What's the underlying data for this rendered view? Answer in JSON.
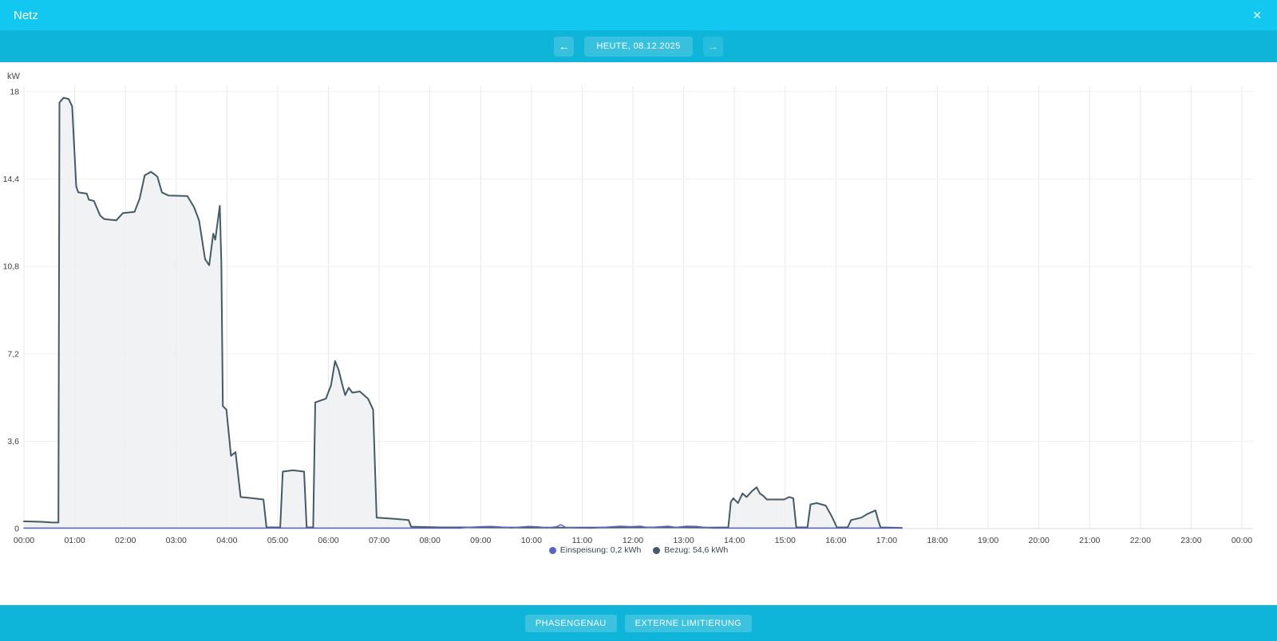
{
  "header": {
    "title": "Netz",
    "close_icon": "✕"
  },
  "nav": {
    "prev_icon": "←",
    "next_icon": "→",
    "date_label": "HEUTE, 08.12.2025"
  },
  "colors": {
    "header_bar": "#12c8f1",
    "toolbar_bar": "#0fb5d8",
    "footer_bar": "#0fb5d8",
    "grid_vertical": "#e9e9e9",
    "grid_horizontal": "#f1f1f1",
    "axis_baseline": "#d8d8d8",
    "tick_text": "#3d3d3d"
  },
  "chart_data": {
    "type": "area",
    "title": "",
    "xlabel": "",
    "ylabel": "kW",
    "xlim": [
      0,
      24
    ],
    "ylim": [
      0,
      18
    ],
    "grid": true,
    "legend_position": "bottom",
    "x_tick_labels": [
      "00:00",
      "01:00",
      "02:00",
      "03:00",
      "04:00",
      "05:00",
      "06:00",
      "07:00",
      "08:00",
      "09:00",
      "10:00",
      "11:00",
      "12:00",
      "13:00",
      "14:00",
      "15:00",
      "16:00",
      "17:00",
      "18:00",
      "19:00",
      "20:00",
      "21:00",
      "22:00",
      "23:00",
      "00:00"
    ],
    "y_ticks": [
      {
        "value": 0,
        "label": "0"
      },
      {
        "value": 3.6,
        "label": "3,6"
      },
      {
        "value": 7.2,
        "label": "7,2"
      },
      {
        "value": 10.8,
        "label": "10,8"
      },
      {
        "value": 14.4,
        "label": "14,4"
      },
      {
        "value": 18,
        "label": "18"
      }
    ],
    "series": [
      {
        "name": "Einspeisung",
        "legend_label": "Einspeisung: 0,2 kWh",
        "total": "0,2 kWh",
        "color": "#5a64c8",
        "fill": "none",
        "points": [
          [
            0,
            0.02
          ],
          [
            8.6,
            0.02
          ],
          [
            8.8,
            0.06
          ],
          [
            9,
            0.08
          ],
          [
            9.2,
            0.09
          ],
          [
            9.45,
            0.06
          ],
          [
            9.6,
            0.03
          ],
          [
            9.75,
            0.06
          ],
          [
            9.95,
            0.09
          ],
          [
            10.15,
            0.07
          ],
          [
            10.3,
            0.03
          ],
          [
            10.5,
            0.08
          ],
          [
            10.58,
            0.16
          ],
          [
            10.68,
            0.05
          ],
          [
            10.9,
            0.03
          ],
          [
            11.2,
            0.02
          ],
          [
            11.55,
            0.07
          ],
          [
            11.75,
            0.1
          ],
          [
            11.95,
            0.08
          ],
          [
            12.15,
            0.1
          ],
          [
            12.3,
            0.04
          ],
          [
            12.55,
            0.08
          ],
          [
            12.7,
            0.1
          ],
          [
            12.85,
            0.05
          ],
          [
            13.05,
            0.1
          ],
          [
            13.25,
            0.09
          ],
          [
            13.45,
            0.04
          ],
          [
            13.6,
            0.02
          ],
          [
            17.3,
            0.02
          ]
        ]
      },
      {
        "name": "Bezug",
        "legend_label": "Bezug: 54,6 kWh",
        "total": "54,6 kWh",
        "color": "#455a64",
        "fill": "#eceff1",
        "points": [
          [
            0,
            0.3
          ],
          [
            0.35,
            0.28
          ],
          [
            0.55,
            0.25
          ],
          [
            0.68,
            0.25
          ],
          [
            0.7,
            17.55
          ],
          [
            0.78,
            17.75
          ],
          [
            0.88,
            17.7
          ],
          [
            0.95,
            17.4
          ],
          [
            1.03,
            14.1
          ],
          [
            1.07,
            13.85
          ],
          [
            1.24,
            13.8
          ],
          [
            1.28,
            13.55
          ],
          [
            1.38,
            13.5
          ],
          [
            1.5,
            12.9
          ],
          [
            1.58,
            12.75
          ],
          [
            1.82,
            12.7
          ],
          [
            1.95,
            13
          ],
          [
            2.18,
            13.05
          ],
          [
            2.28,
            13.6
          ],
          [
            2.38,
            14.55
          ],
          [
            2.5,
            14.7
          ],
          [
            2.57,
            14.6
          ],
          [
            2.63,
            14.5
          ],
          [
            2.72,
            13.85
          ],
          [
            2.85,
            13.72
          ],
          [
            3.22,
            13.7
          ],
          [
            3.35,
            13.25
          ],
          [
            3.45,
            12.7
          ],
          [
            3.57,
            11.1
          ],
          [
            3.65,
            10.85
          ],
          [
            3.73,
            12.15
          ],
          [
            3.77,
            11.9
          ],
          [
            3.86,
            13.3
          ],
          [
            3.89,
            11
          ],
          [
            3.92,
            5.05
          ],
          [
            3.99,
            4.9
          ],
          [
            4.08,
            3
          ],
          [
            4.17,
            3.15
          ],
          [
            4.27,
            1.3
          ],
          [
            4.5,
            1.25
          ],
          [
            4.72,
            1.2
          ],
          [
            4.78,
            0.05
          ],
          [
            5.05,
            0.05
          ],
          [
            5.1,
            2.35
          ],
          [
            5.3,
            2.4
          ],
          [
            5.52,
            2.35
          ],
          [
            5.57,
            0.05
          ],
          [
            5.7,
            0.05
          ],
          [
            5.74,
            5.2
          ],
          [
            5.95,
            5.35
          ],
          [
            6.05,
            5.9
          ],
          [
            6.13,
            6.9
          ],
          [
            6.2,
            6.55
          ],
          [
            6.27,
            5.95
          ],
          [
            6.33,
            5.5
          ],
          [
            6.4,
            5.8
          ],
          [
            6.47,
            5.6
          ],
          [
            6.62,
            5.65
          ],
          [
            6.78,
            5.35
          ],
          [
            6.88,
            4.9
          ],
          [
            6.95,
            0.45
          ],
          [
            7.3,
            0.4
          ],
          [
            7.58,
            0.35
          ],
          [
            7.63,
            0.08
          ],
          [
            8.2,
            0.05
          ],
          [
            9,
            0.05
          ],
          [
            10,
            0.04
          ],
          [
            11,
            0.04
          ],
          [
            12,
            0.05
          ],
          [
            13,
            0.05
          ],
          [
            13.55,
            0.04
          ],
          [
            13.88,
            0.05
          ],
          [
            13.93,
            1.1
          ],
          [
            13.98,
            1.25
          ],
          [
            14.07,
            1.05
          ],
          [
            14.16,
            1.45
          ],
          [
            14.24,
            1.3
          ],
          [
            14.35,
            1.55
          ],
          [
            14.44,
            1.7
          ],
          [
            14.5,
            1.45
          ],
          [
            14.57,
            1.35
          ],
          [
            14.64,
            1.2
          ],
          [
            14.98,
            1.2
          ],
          [
            15.08,
            1.3
          ],
          [
            15.16,
            1.25
          ],
          [
            15.22,
            0.05
          ],
          [
            15.44,
            0.05
          ],
          [
            15.5,
            1
          ],
          [
            15.62,
            1.05
          ],
          [
            15.8,
            0.95
          ],
          [
            15.92,
            0.5
          ],
          [
            16.02,
            0.05
          ],
          [
            16.23,
            0.05
          ],
          [
            16.3,
            0.35
          ],
          [
            16.5,
            0.45
          ],
          [
            16.62,
            0.6
          ],
          [
            16.78,
            0.75
          ],
          [
            16.84,
            0.3
          ],
          [
            16.88,
            0.05
          ],
          [
            17.3,
            0.03
          ]
        ]
      }
    ]
  },
  "footer": {
    "buttons": [
      {
        "label": "PHASENGENAU"
      },
      {
        "label": "EXTERNE LIMITIERUNG"
      }
    ]
  }
}
